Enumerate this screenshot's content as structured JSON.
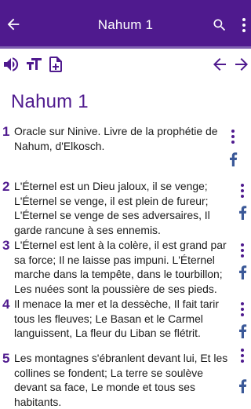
{
  "app_bar": {
    "title": "Nahum 1",
    "color": "#4f1a8e"
  },
  "toolbar": {
    "icons": [
      "speaker-icon",
      "text-size-icon",
      "add-note-icon",
      "arrow-left-icon",
      "arrow-right-icon"
    ]
  },
  "chapter": {
    "title": "Nahum 1"
  },
  "verses": [
    {
      "number": "1",
      "lines": [
        "Oracle sur Ninive. Livre de la prophétie de",
        "Nahum, d'Elkosch."
      ]
    },
    {
      "number": "2",
      "lines": [
        "L'Éternel est un Dieu jaloux, il se venge;",
        "L'Éternel se venge, il est plein de fureur;",
        "L'Éternel se venge de ses adversaires, Il",
        "garde rancune à ses ennemis."
      ]
    },
    {
      "number": "3",
      "lines": [
        "L'Éternel est lent à la colère, il est grand par",
        "sa force; Il ne laisse pas impuni. L'Éternel",
        "marche dans la tempête, dans le tourbillon;",
        "Les nuées sont la poussière de ses pieds."
      ]
    },
    {
      "number": "4",
      "lines": [
        "Il menace la mer et la dessèche, Il fait tarir",
        "tous les fleuves; Le Basan et le Carmel",
        "languissent, La fleur du Liban se flétrit."
      ]
    },
    {
      "number": "5",
      "lines": [
        "Les montagnes s'ébranlent devant lui, Et les",
        "collines se fondent; La terre se soulève",
        "devant sa face, Le monde et tous ses",
        "habitants."
      ]
    }
  ]
}
